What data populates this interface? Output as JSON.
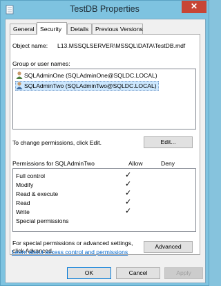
{
  "window": {
    "title": "TestDB Properties",
    "close_glyph": "✕"
  },
  "tabs": [
    {
      "label": "General"
    },
    {
      "label": "Security"
    },
    {
      "label": "Details"
    },
    {
      "label": "Previous Versions"
    }
  ],
  "object": {
    "label": "Object name:",
    "value": "L13.MSSQLSERVER\\MSSQL\\DATA\\TestDB.mdf"
  },
  "groups": {
    "label": "Group or user names:",
    "items": [
      {
        "name": "SQLAdminOne (SQLAdminOne@SQLDC.LOCAL)"
      },
      {
        "name": "SQLAdminTwo (SQLAdminTwo@SQLDC.LOCAL)"
      }
    ]
  },
  "change": {
    "text": "To change permissions, click Edit.",
    "edit_label": "Edit..."
  },
  "permissions": {
    "header": "Permissions for SQLAdminTwo",
    "allow_header": "Allow",
    "deny_header": "Deny",
    "check_glyph": "✓",
    "rows": [
      {
        "name": "Full control",
        "allow": true
      },
      {
        "name": "Modify",
        "allow": true
      },
      {
        "name": "Read & execute",
        "allow": true
      },
      {
        "name": "Read",
        "allow": true
      },
      {
        "name": "Write",
        "allow": true
      },
      {
        "name": "Special permissions",
        "allow": false
      }
    ]
  },
  "advanced": {
    "text_line1": "For special permissions or advanced settings,",
    "text_line2": "click Advanced.",
    "button_label": "Advanced"
  },
  "learn_link": "Learn about access control and permissions",
  "footer": {
    "ok": "OK",
    "cancel": "Cancel",
    "apply": "Apply"
  }
}
